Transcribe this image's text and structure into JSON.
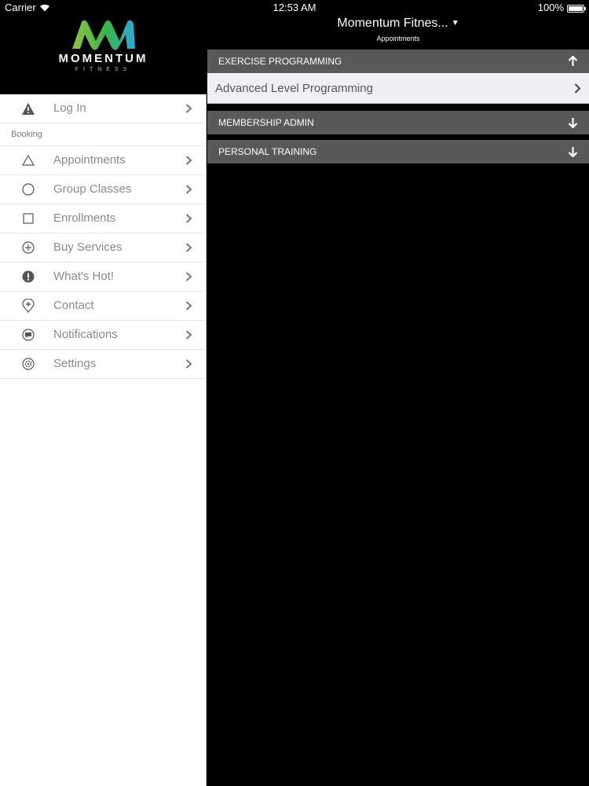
{
  "status_bar": {
    "carrier": "Carrier",
    "time": "12:53 AM",
    "battery": "100%"
  },
  "brand": {
    "name": "MOMENTUM",
    "tagline": "FITNESS",
    "colors": {
      "green": "#8dc63f",
      "blue": "#29abe2"
    }
  },
  "sidebar": {
    "login": {
      "label": "Log In",
      "icon": "warning-icon"
    },
    "section_label": "Booking",
    "items": [
      {
        "label": "Appointments",
        "icon": "triangle-icon"
      },
      {
        "label": "Group Classes",
        "icon": "circle-icon"
      },
      {
        "label": "Enrollments",
        "icon": "square-icon"
      },
      {
        "label": "Buy Services",
        "icon": "plus-circle-icon"
      },
      {
        "label": "What's Hot!",
        "icon": "exclamation-icon"
      },
      {
        "label": "Contact",
        "icon": "location-pin-icon"
      },
      {
        "label": "Notifications",
        "icon": "speech-bubble-icon"
      },
      {
        "label": "Settings",
        "icon": "gear-icon"
      }
    ]
  },
  "header": {
    "title": "Momentum Fitnes...",
    "subtitle": "Appointments"
  },
  "sections": [
    {
      "label": "EXERCISE PROGRAMMING",
      "expanded": true,
      "items": [
        {
          "label": "Advanced Level Programming"
        }
      ]
    },
    {
      "label": "MEMBERSHIP ADMIN",
      "expanded": false
    },
    {
      "label": "PERSONAL TRAINING",
      "expanded": false
    }
  ],
  "colors": {
    "section_header_bg": "#595959",
    "panel_bg": "#000000",
    "row_bg": "#efeff4",
    "menu_text": "#8a8a8a"
  }
}
